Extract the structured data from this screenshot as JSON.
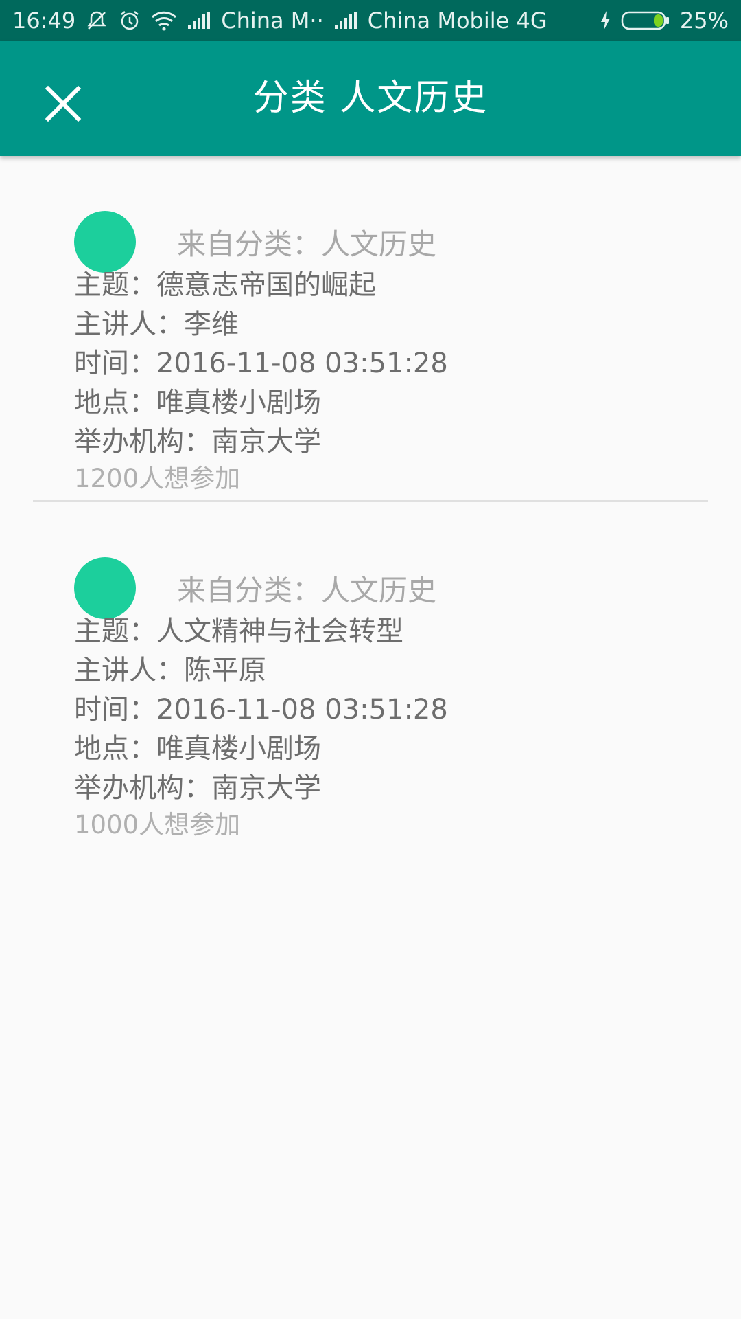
{
  "status_bar": {
    "time": "16:49",
    "carrier1": "China M··",
    "carrier2": "China Mobile 4G",
    "battery": "25%",
    "icons": [
      "mute-icon",
      "alarm-icon",
      "wifi-icon",
      "signal-icon",
      "signal-icon",
      "charging-icon",
      "battery-icon"
    ]
  },
  "app_bar": {
    "title": "分类  人文历史",
    "close_icon": "close-icon"
  },
  "colors": {
    "status_bar": "#00695c",
    "app_bar": "#009688",
    "avatar": "#1ccf9c",
    "background": "#fafafa"
  },
  "items": [
    {
      "category": "来自分类：人文历史",
      "topic": "主题：德意志帝国的崛起",
      "speaker": "主讲人：李维",
      "time": "时间：2016-11-08 03:51:28",
      "location": "地点：唯真楼小剧场",
      "organizer": "举办机构：南京大学",
      "interested": "1200人想参加"
    },
    {
      "category": "来自分类：人文历史",
      "topic": "主题：人文精神与社会转型",
      "speaker": "主讲人：陈平原",
      "time": "时间：2016-11-08 03:51:28",
      "location": "地点：唯真楼小剧场",
      "organizer": "举办机构：南京大学",
      "interested": "1000人想参加"
    }
  ]
}
